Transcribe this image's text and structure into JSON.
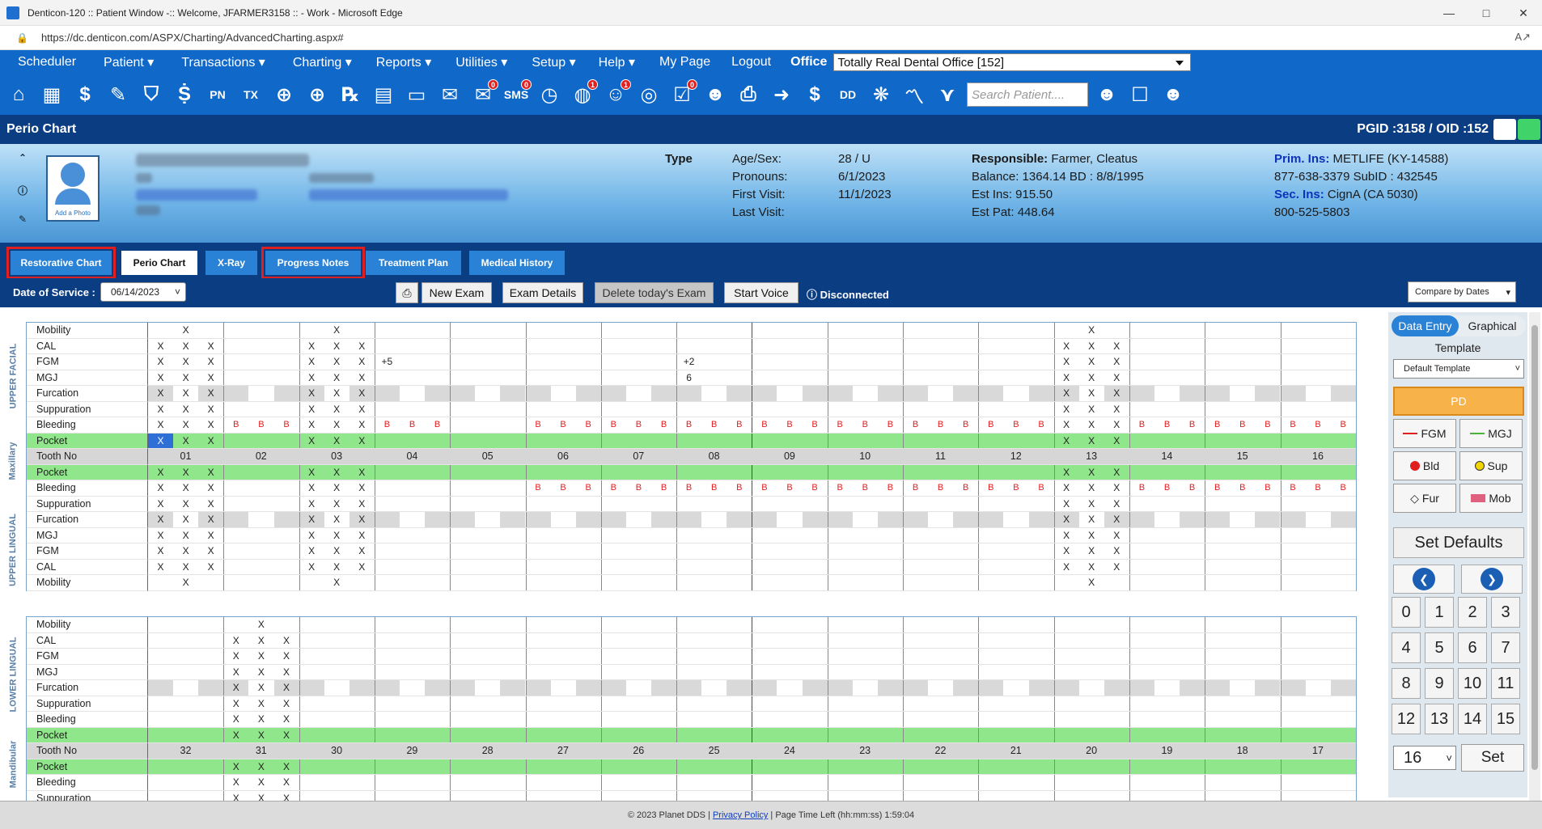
{
  "window": {
    "title": "Denticon-120 :: Patient Window -:: Welcome, JFARMER3158 :: - Work - Microsoft Edge",
    "url": "https://dc.denticon.com/ASPX/Charting/AdvancedCharting.aspx#"
  },
  "menu": {
    "items": [
      "Scheduler",
      "Patient ▾",
      "Transactions ▾",
      "Charting ▾",
      "Reports ▾",
      "Utilities ▾",
      "Setup ▾",
      "Help ▾",
      "My Page",
      "Logout"
    ],
    "office_label": "Office",
    "office_value": "Totally Real Dental Office [152]"
  },
  "iconbar": {
    "icons": [
      "home-icon",
      "calendar-icon",
      "dollar-icon",
      "pen-icon",
      "tooth-icon",
      "implant-icon",
      "pn-icon",
      "tx-icon",
      "add-patient-icon",
      "add-family-icon",
      "rx-icon",
      "notes-icon",
      "scan-icon",
      "mail-icon",
      "chat-icon",
      "sms-icon",
      "clock-icon",
      "globe-alert-icon",
      "support-icon",
      "web-icon",
      "checklist-icon",
      "family-icon",
      "print-icon",
      "route-icon",
      "shield-dollar-icon",
      "dd-icon",
      "network-icon",
      "chart-icon",
      "chevron-shield-icon"
    ],
    "glyphs": [
      "⌂",
      "▦",
      "$",
      "✎",
      "⛉",
      "Ṩ",
      "PN",
      "TX",
      "⊕",
      "⊕",
      "℞",
      "▤",
      "▭",
      "✉",
      "✉",
      "SMS",
      "◷",
      "◍",
      "☺",
      "◎",
      "☑",
      "☻",
      "⎙",
      "➜",
      "$",
      "DD",
      "❋",
      "〽",
      "⋎"
    ],
    "badges": {
      "14": "0",
      "15": "0",
      "17": "1",
      "18": "1",
      "20": "0"
    },
    "search_placeholder": "Search Patient...."
  },
  "perio_header": {
    "title": "Perio Chart",
    "pgid": "PGID :3158  /  OID :152"
  },
  "patient": {
    "photo_label": "Add a Photo",
    "type_label": "Type",
    "age_label": "Age/Sex:",
    "age_value": "28 / U",
    "pronouns_label": "Pronouns:",
    "pronouns_value": "",
    "first_visit_label": "First Visit:",
    "first_visit_value": "6/1/2023",
    "last_visit_label": "Last Visit:",
    "last_visit_value": "11/1/2023",
    "responsible_label": "Responsible:",
    "responsible_value": "Farmer, Cleatus",
    "balance_line": "Balance: 1364.14    BD : 8/8/1995",
    "est_ins_line": "Est Ins:  915.50",
    "est_pat_line": "Est Pat: 448.64",
    "prim_ins_label": "Prim. Ins:",
    "prim_ins_value": "METLIFE (KY-14588)",
    "prim_phone_line": "877-638-3379 SubID : 432545",
    "sec_ins_label": "Sec. Ins:",
    "sec_ins_value": "CignA (CA 5030)",
    "sec_phone_line": "800-525-5803"
  },
  "tabs": [
    "Restorative Chart",
    "Perio Chart",
    "X-Ray",
    "Progress Notes",
    "Treatment Plan",
    "Medical History"
  ],
  "toolbar": {
    "date_label": "Date of Service :",
    "date_value": "06/14/2023",
    "new_exam": "New Exam",
    "exam_details": "Exam Details",
    "delete_exam": "Delete today's Exam",
    "start_voice": "Start Voice",
    "status": "Disconnected",
    "compare": "Compare by Dates"
  },
  "chart": {
    "section_labels": {
      "upper_facial": "UPPER FACIAL",
      "maxillary": "Maxillary",
      "upper_lingual": "UPPER LINGUAL",
      "lower_lingual": "LOWER LINGUAL",
      "mandibular": "Mandibular"
    },
    "upper_teeth": [
      "01",
      "02",
      "03",
      "04",
      "05",
      "06",
      "07",
      "08",
      "09",
      "10",
      "11",
      "12",
      "13",
      "14",
      "15",
      "16"
    ],
    "lower_teeth": [
      "32",
      "31",
      "30",
      "29",
      "28",
      "27",
      "26",
      "25",
      "24",
      "23",
      "22",
      "21",
      "20",
      "19",
      "18",
      "17"
    ],
    "upper_rows": [
      "Mobility",
      "CAL",
      "FGM",
      "MGJ",
      "Furcation",
      "Suppuration",
      "Bleeding",
      "Pocket",
      "Tooth No",
      "Pocket",
      "Bleeding",
      "Suppuration",
      "Furcation",
      "MGJ",
      "FGM",
      "CAL",
      "Mobility"
    ],
    "lower_rows": [
      "Mobility",
      "CAL",
      "FGM",
      "MGJ",
      "Furcation",
      "Suppuration",
      "Bleeding",
      "Pocket",
      "Tooth No",
      "Pocket",
      "Bleeding",
      "Suppuration"
    ],
    "mark_x": "X",
    "mark_b": "B",
    "fgm_plus5": "+5",
    "fgm_plus2": "+2",
    "mgj_6": "6"
  },
  "right_panel": {
    "tab_data_entry": "Data Entry",
    "tab_graphical": "Graphical",
    "template_label": "Template",
    "template_value": "Default Template",
    "pd": "PD",
    "fgm": "FGM",
    "mgj": "MGJ",
    "bld": "Bld",
    "sup": "Sup",
    "fur": "Fur",
    "mob": "Mob",
    "set_defaults": "Set Defaults",
    "keys": [
      "0",
      "1",
      "2",
      "3",
      "4",
      "5",
      "6",
      "7",
      "8",
      "9",
      "10",
      "11",
      "12",
      "13",
      "14",
      "15"
    ],
    "tooth_select": "16",
    "set": "Set"
  },
  "footer": {
    "copyright": "© 2023 Planet DDS |",
    "privacy": "Privacy Policy",
    "time_left": "| Page Time Left (hh:mm:ss) 1:59:04"
  }
}
